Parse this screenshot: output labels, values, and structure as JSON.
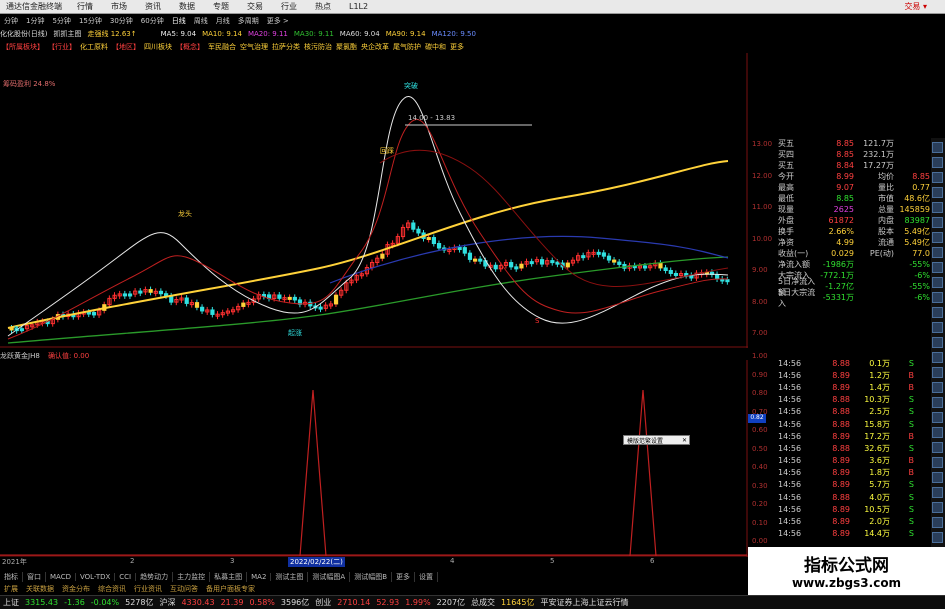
{
  "menubar": {
    "title": "通达信金融终端",
    "items": [
      "行情",
      "市场",
      "资讯",
      "数据",
      "专题",
      "交易",
      "行业",
      "热点",
      "L1L2"
    ],
    "right": "交易 ▾"
  },
  "periodbar": {
    "items": [
      "分钟",
      "1分钟",
      "5分钟",
      "15分钟",
      "30分钟",
      "60分钟",
      "日线",
      "周线",
      "月线",
      "多周期",
      "更多 >"
    ]
  },
  "infobar": {
    "stock": "化化股份(日线)",
    "main": "抓抓主图",
    "strength": "走强线 12.63↑",
    "ma5": "MA5: 9.04",
    "ma10": "MA10: 9.14",
    "ma20": "MA20: 9.11",
    "ma30": "MA30: 9.11",
    "ma60": "MA60: 9.04",
    "ma90": "MA90: 9.14",
    "ma120": "MA120: 9.50"
  },
  "sectors": [
    "【所属板块】",
    "【行业】",
    "化工原料",
    "【地区】",
    "四川板块",
    "【概念】",
    "军民融合",
    "空气治理",
    "拉萨分类",
    "核污防治",
    "聚氯酯",
    "央企改革",
    "尾气防护",
    "碳中和",
    "更多"
  ],
  "chip": "筹码盈利 24.8%",
  "annotations": {
    "range_label": "14.00 - 13.83",
    "breakout": "突破",
    "dragon_head": "龙头",
    "pullback": "回踩",
    "start": "起涨",
    "sell": "S",
    "buy": "B"
  },
  "indicator": {
    "name": "龙跃黄金JH8",
    "value": "确认值: 0.00",
    "marker": "0.82",
    "popup": "模版范繁设置"
  },
  "yaxis_top": [
    "13.00",
    "12.00",
    "11.00",
    "10.00",
    "9.00",
    "8.00",
    "7.00"
  ],
  "yaxis_bottom": [
    "1.00",
    "0.90",
    "0.80",
    "0.70",
    "0.60",
    "0.50",
    "0.40",
    "0.30",
    "0.20",
    "0.10",
    "0.00"
  ],
  "xaxis": {
    "labels": [
      "2021年",
      "2",
      "3",
      "4",
      "5",
      "6"
    ],
    "highlight": "2022/02/22(二)"
  },
  "tabs": [
    "指标",
    "窗口",
    "MACD",
    "VOL-TDX",
    "CCI",
    "趋势动力",
    "主力监控",
    "私募主图",
    "MA2",
    "测试主图",
    "测试幅图A",
    "测试幅图B",
    "更多",
    "设置"
  ],
  "tabs2": [
    "扩展",
    "关联数据",
    "资金分布",
    "综合资讯",
    "行业资讯",
    "互动问答",
    "备用户面板专家"
  ],
  "quote": {
    "rows": [
      {
        "a": "买五",
        "b": "8.85",
        "c": "121.7万",
        "d": ""
      },
      {
        "a": "买四",
        "b": "8.85",
        "c": "232.1万",
        "d": ""
      },
      {
        "a": "买五",
        "b": "8.84",
        "c": "17.27万",
        "d": ""
      },
      {
        "a": "今开",
        "b": "8.99",
        "c": "均价",
        "d": "8.85"
      },
      {
        "a": "最高",
        "b": "9.07",
        "c": "量比",
        "d": "0.77"
      },
      {
        "a": "最低",
        "b": "8.85",
        "c": "市值",
        "d": "48.6亿"
      },
      {
        "a": "现量",
        "b": "2625",
        "c": "总量",
        "d": "145859"
      },
      {
        "a": "外盘",
        "b": "61872",
        "c": "内盘",
        "d": "83987"
      },
      {
        "a": "换手",
        "b": "2.66%",
        "c": "股本",
        "d": "5.49亿"
      },
      {
        "a": "净资",
        "b": "4.99",
        "c": "流通",
        "d": "5.49亿"
      },
      {
        "a": "收益(一)",
        "b": "0.029",
        "c": "PE(动)",
        "d": "77.0"
      },
      {
        "a": "净流入额",
        "b": "-1986万",
        "c": "",
        "d": "-55%"
      },
      {
        "a": "大宗流入",
        "b": "-772.1万",
        "c": "",
        "d": "-6%"
      },
      {
        "a": "5日净流入额",
        "b": "-1.27亿",
        "c": "",
        "d": "-55%"
      },
      {
        "a": "5日大宗流入",
        "b": "-5331万",
        "c": "",
        "d": "-6%"
      }
    ]
  },
  "ticks": [
    {
      "t": "14:56",
      "p": "8.88",
      "v": "0.1万",
      "s": "S"
    },
    {
      "t": "14:56",
      "p": "8.89",
      "v": "1.2万",
      "s": "B"
    },
    {
      "t": "14:56",
      "p": "8.89",
      "v": "1.4万",
      "s": "B"
    },
    {
      "t": "14:56",
      "p": "8.88",
      "v": "10.3万",
      "s": "S"
    },
    {
      "t": "14:56",
      "p": "8.88",
      "v": "2.5万",
      "s": "S"
    },
    {
      "t": "14:56",
      "p": "8.88",
      "v": "15.8万",
      "s": "S"
    },
    {
      "t": "14:56",
      "p": "8.89",
      "v": "17.2万",
      "s": "B"
    },
    {
      "t": "14:56",
      "p": "8.88",
      "v": "32.6万",
      "s": "S"
    },
    {
      "t": "14:56",
      "p": "8.89",
      "v": "3.6万",
      "s": "B"
    },
    {
      "t": "14:56",
      "p": "8.89",
      "v": "1.8万",
      "s": "B"
    },
    {
      "t": "14:56",
      "p": "8.89",
      "v": "5.7万",
      "s": "S"
    },
    {
      "t": "14:56",
      "p": "8.88",
      "v": "4.0万",
      "s": "S"
    },
    {
      "t": "14:56",
      "p": "8.89",
      "v": "10.5万",
      "s": "S"
    },
    {
      "t": "14:56",
      "p": "8.89",
      "v": "2.0万",
      "s": "S"
    },
    {
      "t": "14:56",
      "p": "8.89",
      "v": "14.4万",
      "s": "S"
    }
  ],
  "status": {
    "sh_label": "上证",
    "sh_value": "3315.43",
    "sh_change": "-1.36",
    "sh_pct": "-0.04%",
    "sh_amount": "5278亿",
    "sz_label": "沪深",
    "sz_value": "4330.43",
    "sz_change": "21.39",
    "sz_pct": "0.58%",
    "sz_amount": "3596亿",
    "cy_label": "创业",
    "cy_value": "2710.14",
    "cy_change": "52.93",
    "cy_pct": "1.99%",
    "cy_amount": "2207亿",
    "total_label": "总成交",
    "total_value": "11645亿",
    "news": "平安证券上海上证云行情"
  },
  "watermark": {
    "line1": "指标公式网",
    "line2": "www.zbgs3.com"
  },
  "colors": {
    "up": "#ff3030",
    "down": "#30e0e0",
    "accent": "#ffd23a",
    "ma_green": "#20a020"
  }
}
